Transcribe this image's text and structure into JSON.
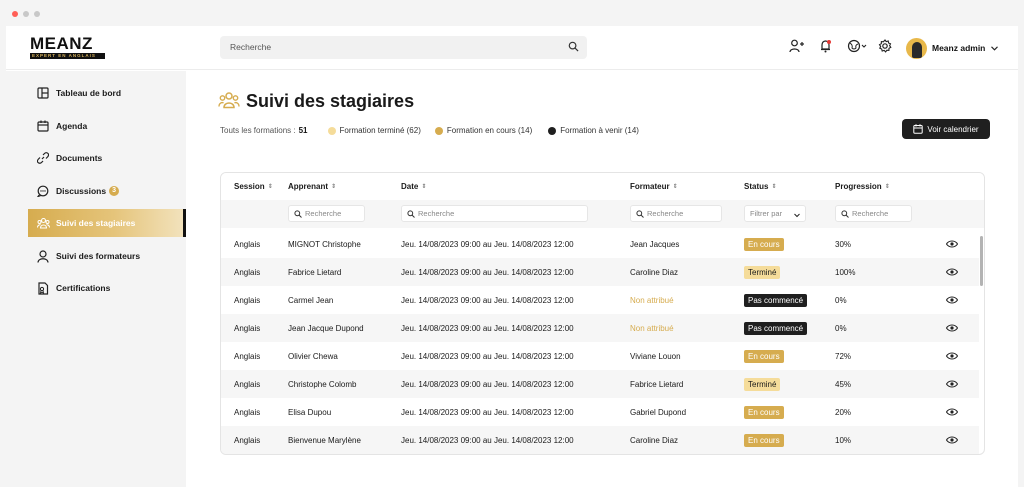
{
  "colors": {
    "accent": "#d6ac4f",
    "accent_light": "#f5dc9a",
    "dark": "#1f1f1f"
  },
  "brand": {
    "name": "MEANZ",
    "tagline": "EXPERT EN ANGLAIS"
  },
  "header": {
    "search_placeholder": "Recherche",
    "icons": [
      "add-user-icon",
      "bell-icon",
      "globe-icon",
      "gear-icon"
    ],
    "user_name": "Meanz admin"
  },
  "sidebar": {
    "items": [
      {
        "label": "Tableau de bord",
        "icon": "dashboard-icon"
      },
      {
        "label": "Agenda",
        "icon": "calendar-icon"
      },
      {
        "label": "Documents",
        "icon": "link-icon"
      },
      {
        "label": "Discussions",
        "icon": "chat-icon",
        "badge": "3"
      },
      {
        "label": "Suivi des stagiaires",
        "icon": "users-icon",
        "active": true
      },
      {
        "label": "Suivi des formateurs",
        "icon": "user-icon"
      },
      {
        "label": "Certifications",
        "icon": "certificate-icon"
      }
    ]
  },
  "main": {
    "title": "Suivi des stagiaires",
    "total_label": "Touts les formations :",
    "total_value": "51",
    "legend": [
      {
        "label": "Formation terminé (62)",
        "color": "#f5dc9a"
      },
      {
        "label": "Formation en cours (14)",
        "color": "#d6ac4f"
      },
      {
        "label": "Formation à venir (14)",
        "color": "#1f1f1f"
      }
    ],
    "calendar_button": "Voir calendrier",
    "table": {
      "columns": [
        "Session",
        "Apprenant",
        "Date",
        "Formateur",
        "Status",
        "Progression"
      ],
      "filters": {
        "apprenant": "Recherche",
        "date": "Recherche",
        "formateur": "Recherche",
        "status": "Filtrer par",
        "progression": "Recherche"
      },
      "rows": [
        {
          "session": "Anglais",
          "apprenant": "MIGNOT Christophe",
          "date": "Jeu. 14/08/2023 09:00 au Jeu. 14/08/2023 12:00",
          "formateur": "Jean Jacques",
          "status": "En cours",
          "status_type": "encours",
          "progression": "30%"
        },
        {
          "session": "Anglais",
          "apprenant": "Fabrice Lietard",
          "date": "Jeu. 14/08/2023 09:00 au Jeu. 14/08/2023 12:00",
          "formateur": "Caroline Diaz",
          "status": "Terminé",
          "status_type": "termine",
          "progression": "100%"
        },
        {
          "session": "Anglais",
          "apprenant": "Carmel Jean",
          "date": "Jeu. 14/08/2023 09:00 au Jeu. 14/08/2023 12:00",
          "formateur": "Non attribué",
          "formateur_unassigned": true,
          "status": "Pas commencé",
          "status_type": "pas",
          "progression": "0%"
        },
        {
          "session": "Anglais",
          "apprenant": "Jean Jacque Dupond",
          "date": "Jeu. 14/08/2023 09:00 au Jeu. 14/08/2023 12:00",
          "formateur": "Non attribué",
          "formateur_unassigned": true,
          "status": "Pas commencé",
          "status_type": "pas",
          "progression": "0%"
        },
        {
          "session": "Anglais",
          "apprenant": "Olivier Chewa",
          "date": "Jeu. 14/08/2023 09:00 au Jeu. 14/08/2023 12:00",
          "formateur": "Viviane Louon",
          "status": "En cours",
          "status_type": "encours",
          "progression": "72%"
        },
        {
          "session": "Anglais",
          "apprenant": "Christophe Colomb",
          "date": "Jeu. 14/08/2023 09:00 au Jeu. 14/08/2023 12:00",
          "formateur": "Fabrice Lietard",
          "status": "Terminé",
          "status_type": "termine",
          "progression": "45%"
        },
        {
          "session": "Anglais",
          "apprenant": "Elisa Dupou",
          "date": "Jeu. 14/08/2023 09:00 au Jeu. 14/08/2023 12:00",
          "formateur": "Gabriel Dupond",
          "status": "En cours",
          "status_type": "encours",
          "progression": "20%"
        },
        {
          "session": "Anglais",
          "apprenant": "Bienvenue Marylène",
          "date": "Jeu. 14/08/2023 09:00 au Jeu. 14/08/2023 12:00",
          "formateur": "Caroline Diaz",
          "status": "En cours",
          "status_type": "encours",
          "progression": "10%"
        }
      ]
    }
  }
}
